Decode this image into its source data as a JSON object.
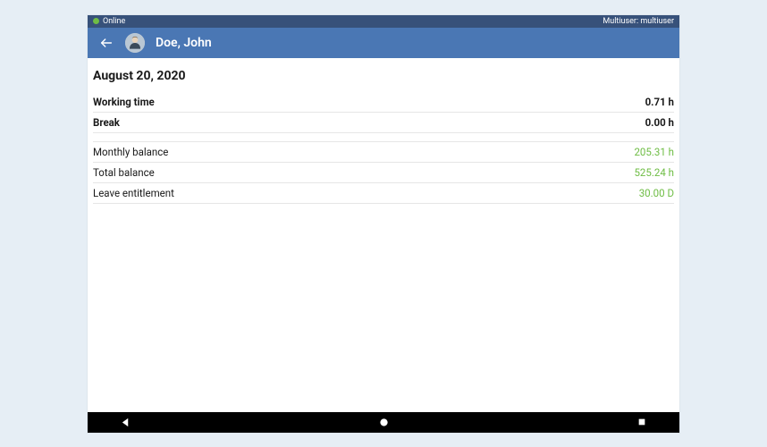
{
  "statusbar": {
    "online_label": "Online",
    "right_label": "Multiuser: multiuser"
  },
  "appbar": {
    "title": "Doe, John"
  },
  "content": {
    "date": "August 20, 2020",
    "rows_primary": [
      {
        "label": "Working time",
        "value": "0.71 h",
        "bold": true,
        "positive": false
      },
      {
        "label": "Break",
        "value": "0.00 h",
        "bold": true,
        "positive": false
      }
    ],
    "rows_secondary": [
      {
        "label": "Monthly balance",
        "value": "205.31 h",
        "bold": false,
        "positive": true
      },
      {
        "label": "Total balance",
        "value": "525.24 h",
        "bold": false,
        "positive": true
      },
      {
        "label": "Leave entitlement",
        "value": "30.00 D",
        "bold": false,
        "positive": true
      }
    ]
  },
  "colors": {
    "statusbar_bg": "#37517a",
    "appbar_bg": "#4a77b4",
    "positive": "#6fbd45"
  }
}
